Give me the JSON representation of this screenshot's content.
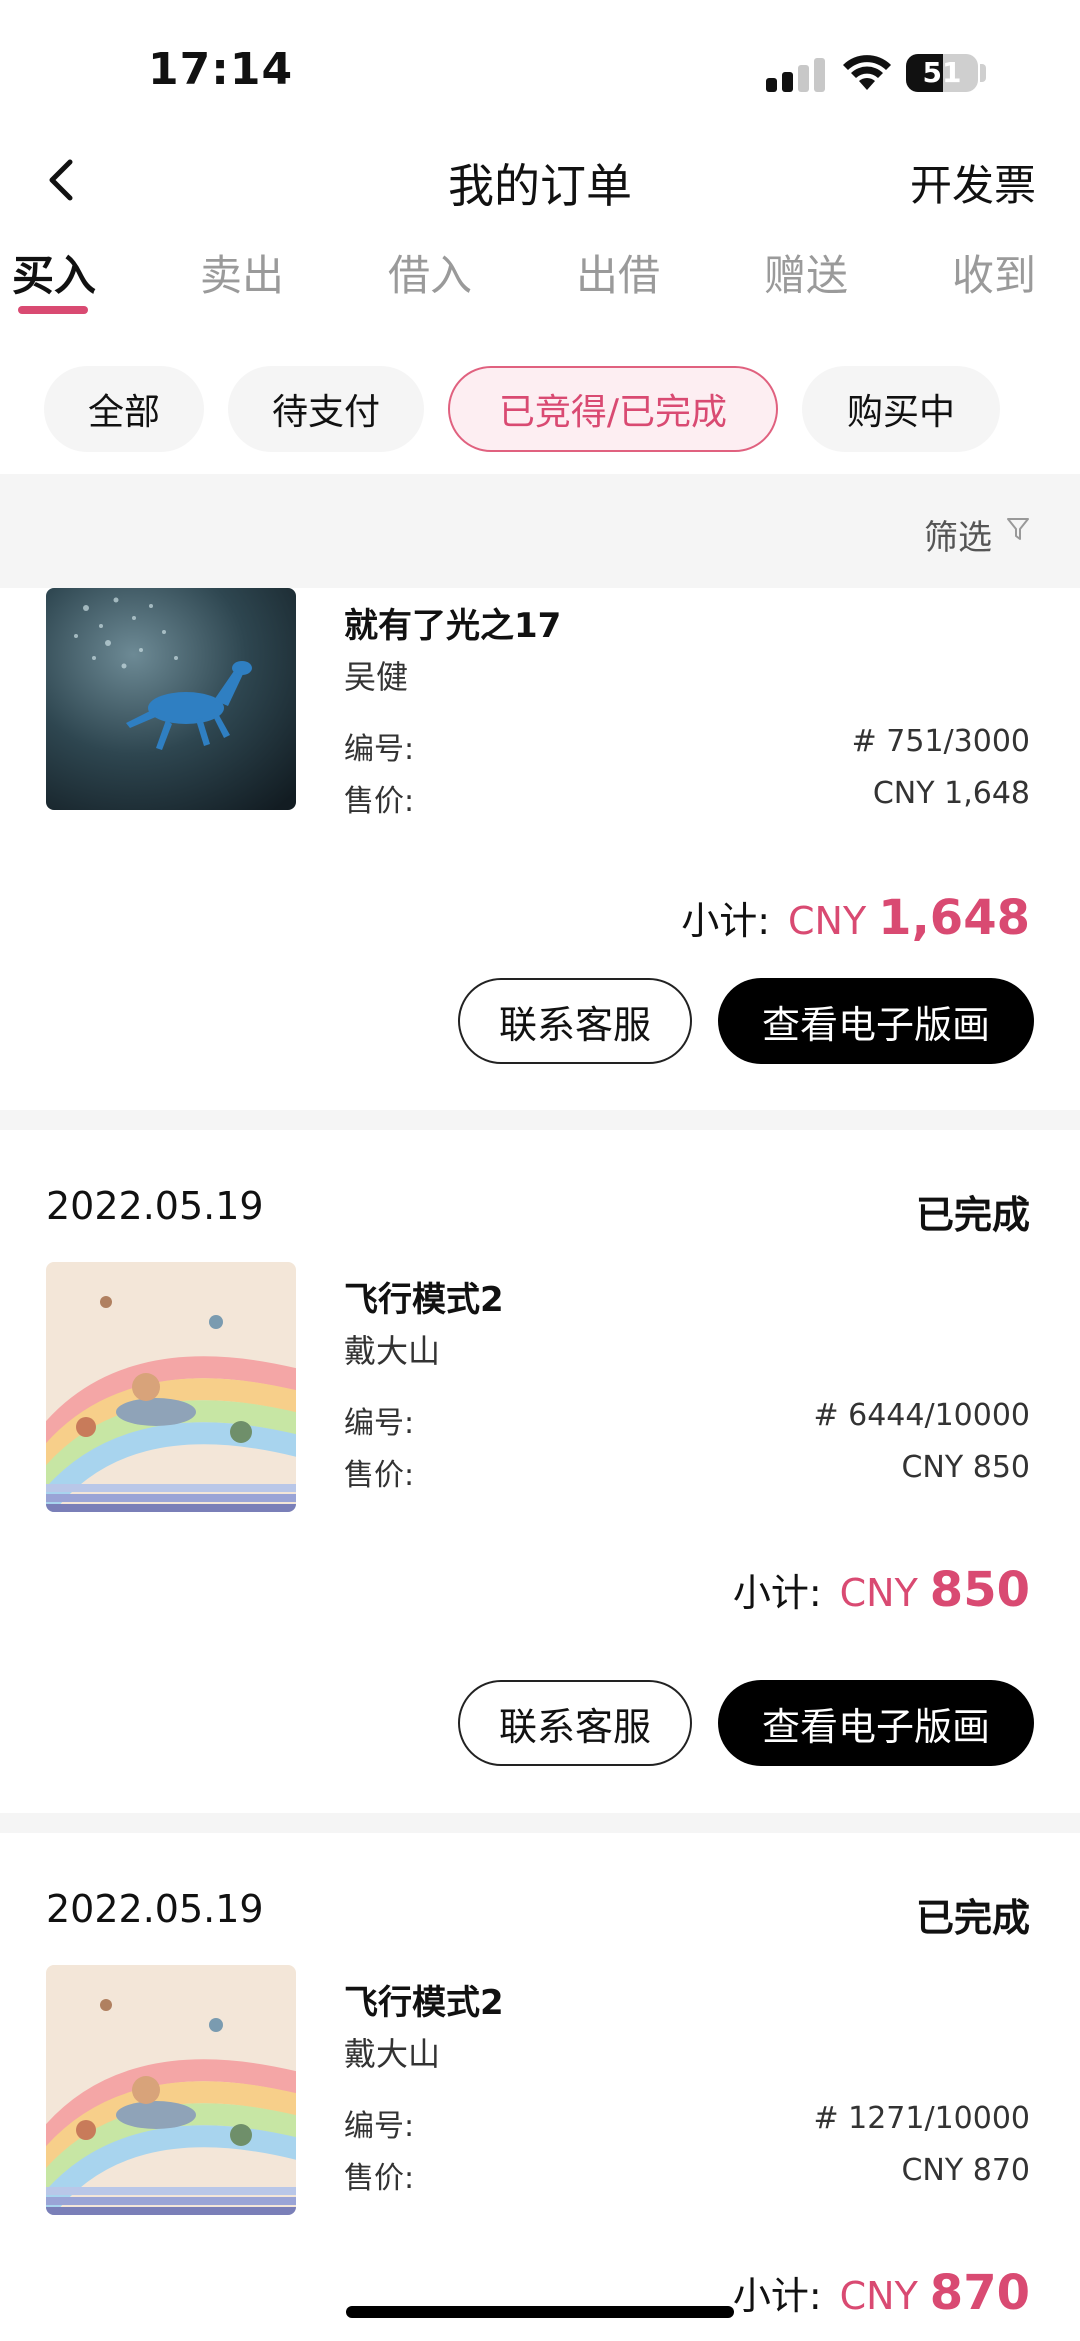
{
  "status_bar": {
    "time": "17:14",
    "battery": "51",
    "battery_level": 0.51
  },
  "nav": {
    "title": "我的订单",
    "invoice": "开发票"
  },
  "tabs": [
    {
      "label": "买入"
    },
    {
      "label": "卖出"
    },
    {
      "label": "借入"
    },
    {
      "label": "出借"
    },
    {
      "label": "赠送"
    },
    {
      "label": "收到"
    }
  ],
  "chips": [
    {
      "label": "全部"
    },
    {
      "label": "待支付"
    },
    {
      "label": "已竞得/已完成"
    },
    {
      "label": "购买中"
    }
  ],
  "filter": {
    "label": "筛选"
  },
  "labels": {
    "serial": "编号:",
    "price": "售价:",
    "subtotal": "小计:",
    "currency": "CNY"
  },
  "buttons": {
    "contact": "联系客服",
    "view": "查看电子版画"
  },
  "orders": [
    {
      "title": "就有了光之17",
      "artist": "吴健",
      "serial": "# 751/3000",
      "price": "CNY 1,648",
      "subtotal": "1,648"
    },
    {
      "date": "2022.05.19",
      "status": "已完成",
      "title": "飞行模式2",
      "artist": "戴大山",
      "serial": "# 6444/10000",
      "price": "CNY 850",
      "subtotal": "850"
    },
    {
      "date": "2022.05.19",
      "status": "已完成",
      "title": "飞行模式2",
      "artist": "戴大山",
      "serial": "# 1271/10000",
      "price": "CNY 870",
      "subtotal": "870"
    }
  ]
}
